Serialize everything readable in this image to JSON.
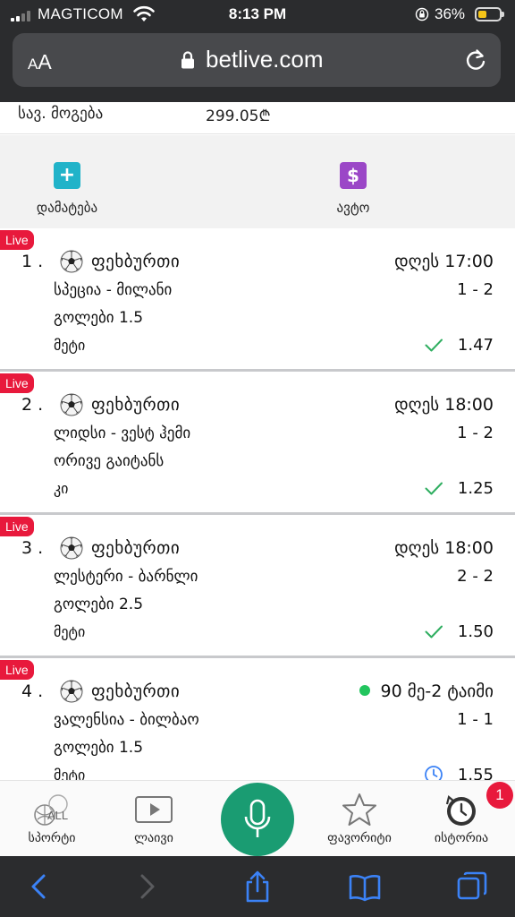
{
  "status_bar": {
    "carrier": "MAGTICOM",
    "time": "8:13 PM",
    "battery_percent": "36%",
    "battery_level": 0.36,
    "icons": [
      "signal-icon",
      "wifi-icon",
      "orientation-lock-icon",
      "battery-icon"
    ]
  },
  "browser": {
    "aa_small": "A",
    "aa_large": "A",
    "url": "betlive.com",
    "icons": [
      "lock-icon",
      "reload-icon"
    ]
  },
  "summary": {
    "label": "სავ. მოგება",
    "value": "299.05₾"
  },
  "actions": {
    "add_label": "დამატება",
    "add_icon": "+",
    "auto_label": "ავტო",
    "auto_icon": "$",
    "colors": {
      "add": "#21b3c9",
      "auto": "#9b47c7"
    }
  },
  "bets": [
    {
      "live": "Live",
      "number": "1 .",
      "sport": "ფეხბურთი",
      "time": "დღეს 17:00",
      "in_play": false,
      "match": "სპეცია - მილანი",
      "score": "1 - 2",
      "market": "გოლები 1.5",
      "pick": "მეტი",
      "status": "won",
      "odds": "1.47"
    },
    {
      "live": "Live",
      "number": "2 .",
      "sport": "ფეხბურთი",
      "time": "დღეს 18:00",
      "in_play": false,
      "match": "ლიდსი - ვესტ ჰემი",
      "score": "1 - 2",
      "market": "ორივე გაიტანს",
      "pick": "კი",
      "status": "won",
      "odds": "1.25"
    },
    {
      "live": "Live",
      "number": "3 .",
      "sport": "ფეხბურთი",
      "time": "დღეს 18:00",
      "in_play": false,
      "match": "ლესტერი - ბარნლი",
      "score": "2 - 2",
      "market": "გოლები 2.5",
      "pick": "მეტი",
      "status": "won",
      "odds": "1.50"
    },
    {
      "live": "Live",
      "number": "4 .",
      "sport": "ფეხბურთი",
      "time": "90 მე-2 ტაიმი",
      "in_play": true,
      "match": "ვალენსია - ბილბაო",
      "score": "1 - 1",
      "market": "გოლები 1.5",
      "pick": "მეტი",
      "status": "pending",
      "odds": "1.55"
    }
  ],
  "app_nav": {
    "sports_label": "სპორტი",
    "sports_icon_text": "ALL",
    "live_label": "ლაივი",
    "favorites_label": "ფავორიტი",
    "history_label": "ისტორია",
    "history_badge": "1",
    "accent": "#1a9c72"
  },
  "safari_toolbar": {
    "icons": [
      "back-icon",
      "forward-icon",
      "share-icon",
      "bookmarks-icon",
      "tabs-icon"
    ],
    "accent": "#3b82f6"
  },
  "colors": {
    "live_badge": "#e8193c",
    "check": "#2fae60",
    "pending": "#3b82f6"
  }
}
